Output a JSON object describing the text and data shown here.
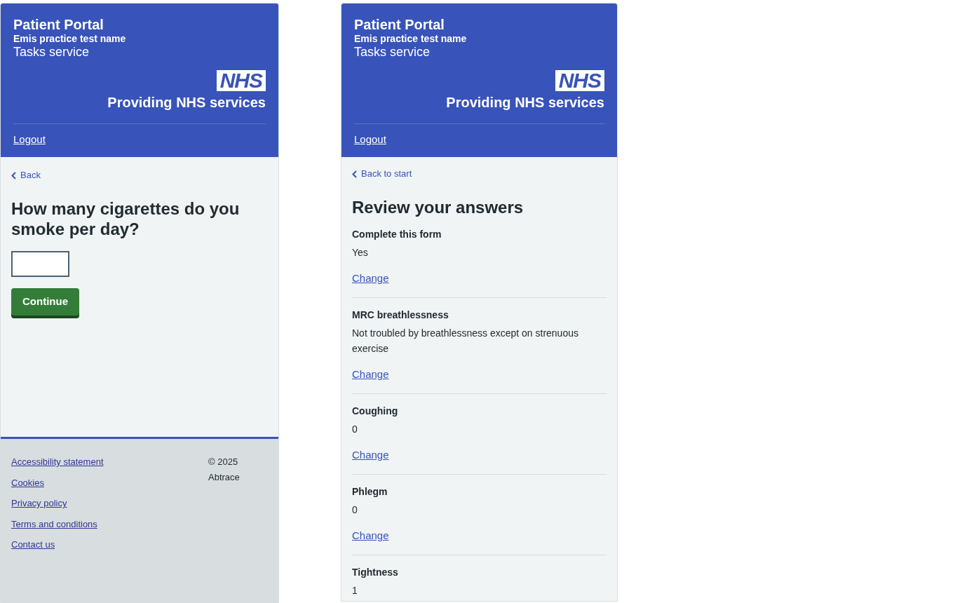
{
  "screens": [
    {
      "kind": "question",
      "header": {
        "title": "Patient Portal",
        "practice": "Emis practice test name",
        "service": "Tasks service",
        "logo": "NHS",
        "tagline": "Providing NHS services",
        "logout": "Logout"
      },
      "back_link": "Back",
      "question": "How many cigarettes do you smoke per day?",
      "button": "Continue",
      "footer": {
        "links": [
          "Accessibility statement",
          "Cookies",
          "Privacy policy",
          "Terms and conditions",
          "Contact us"
        ],
        "copyright": "© 2025 Abtrace"
      }
    },
    {
      "kind": "review",
      "header": {
        "title": "Patient Portal",
        "practice": "Emis practice test name",
        "service": "Tasks service",
        "logo": "NHS",
        "tagline": "Providing NHS services",
        "logout": "Logout"
      },
      "back_link": "Back to start",
      "title": "Review your answers",
      "answers": [
        {
          "label": "Complete this form",
          "value": "Yes",
          "change_link": "Change"
        },
        {
          "label": "MRC breathlessness",
          "value": "Not troubled by breathlessness except on strenuous exercise",
          "change_link": "Change"
        },
        {
          "label": "Coughing",
          "value": "0",
          "change_link": "Change"
        },
        {
          "label": "Phlegm",
          "value": "0",
          "change_link": "Change"
        },
        {
          "label": "Tightness",
          "value": "1"
        }
      ]
    }
  ]
}
